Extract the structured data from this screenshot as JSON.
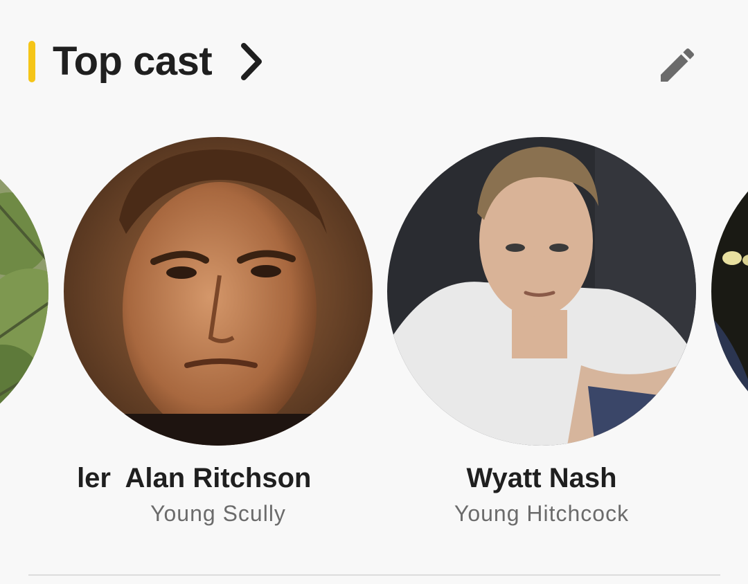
{
  "section": {
    "title": "Top cast",
    "accent_color": "#f5c518",
    "see_all_icon": "chevron-right-icon",
    "edit_icon": "pencil-icon"
  },
  "cast": [
    {
      "name": "…ler",
      "name_visible": "ler",
      "character": "",
      "photo": "outdoor-headshot"
    },
    {
      "name": "Alan Ritchson",
      "character": "Young Scully",
      "photo": "headshot"
    },
    {
      "name": "Wyatt Nash",
      "character": "Young Hitchcock",
      "photo": "headshot"
    },
    {
      "name": "",
      "character": "",
      "photo": "headshot"
    }
  ]
}
